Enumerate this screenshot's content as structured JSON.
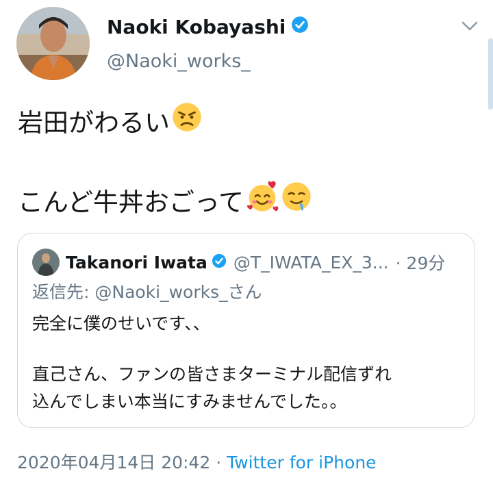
{
  "author": {
    "name": "Naoki Kobayashi",
    "handle": "@Naoki_works_",
    "verified": true,
    "avatar_icon": "profile-photo"
  },
  "tweet": {
    "line1": "岩田がわるい",
    "line1_emoji": "angry-face-emoji",
    "line2": "こんど牛丼おごって",
    "line2_emojis": [
      "smiling-face-with-hearts-emoji",
      "drooling-face-emoji"
    ]
  },
  "quoted_tweet": {
    "name": "Takanori Iwata",
    "handle": "@T_IWATA_EX_3...",
    "time": "· 29分",
    "verified": true,
    "reply_to": "返信先: @Naoki_works_さん",
    "text_line1": "完全に僕のせいです、、",
    "text_line2": "直己さん、ファンの皆さまターミナル配信ずれ",
    "text_line3": "込んでしまい本当にすみませんでした。。"
  },
  "footer": {
    "datetime": "2020年04月14日 20:42",
    "separator": " · ",
    "source": "Twitter for iPhone"
  },
  "colors": {
    "verified_blue": "#1da1f2",
    "muted_text": "#657786",
    "link_blue": "#1b95e0",
    "border": "#cfd9de"
  }
}
